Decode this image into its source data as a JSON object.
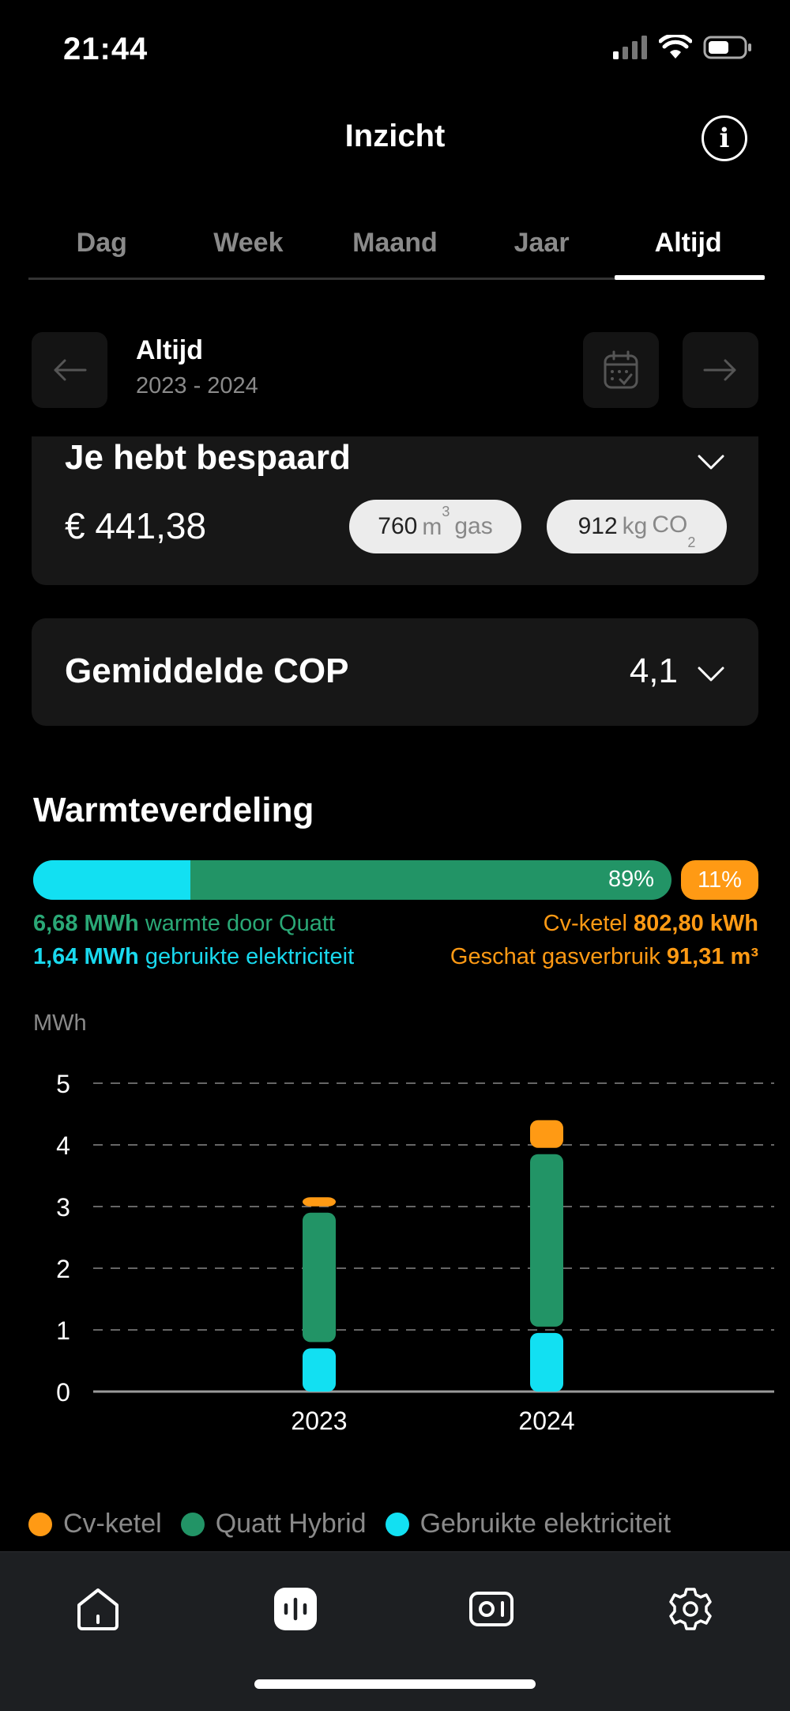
{
  "status_bar": {
    "time": "21:44"
  },
  "header": {
    "title": "Inzicht",
    "info_icon": "info-icon"
  },
  "tabs": [
    {
      "label": "Dag",
      "active": false
    },
    {
      "label": "Week",
      "active": false
    },
    {
      "label": "Maand",
      "active": false
    },
    {
      "label": "Jaar",
      "active": false
    },
    {
      "label": "Altijd",
      "active": true
    }
  ],
  "period": {
    "title": "Altijd",
    "range": "2023 - 2024"
  },
  "savings": {
    "title": "Je hebt bespaard",
    "amount": "€ 441,38",
    "gas_value": "760",
    "gas_unit_base": "m",
    "gas_unit_sup": "3",
    "gas_label": "gas",
    "co2_value": "912",
    "co2_unit": "kg",
    "co2_label": "CO",
    "co2_sub": "2"
  },
  "cop": {
    "title": "Gemiddelde COP",
    "value": "4,1"
  },
  "heat_distribution": {
    "title": "Warmteverdeling",
    "quatt_percent": 89,
    "cv_percent": 11,
    "electricity_fraction_of_quatt": 0.246,
    "quatt_percent_label": "89%",
    "cv_percent_label": "11%",
    "quatt_heat_value": "6,68 MWh",
    "quatt_heat_label": "warmte door Quatt",
    "electricity_value": "1,64 MWh",
    "electricity_label": "gebruikte elektriciteit",
    "cv_label": "Cv-ketel",
    "cv_value": "802,80 kWh",
    "gas_estimate_label": "Geschat gasverbruik",
    "gas_estimate_value": "91,31 m³"
  },
  "chart_data": {
    "type": "bar",
    "stacked": true,
    "ylabel": "MWh",
    "ylim": [
      0,
      5
    ],
    "yticks": [
      "0",
      "1",
      "2",
      "3",
      "4",
      "5"
    ],
    "categories": [
      "2023",
      "2024"
    ],
    "series": [
      {
        "name": "Gebruikte elektriciteit",
        "color": "#12e0f2",
        "values": [
          0.7,
          0.95
        ]
      },
      {
        "name": "Quatt Hybrid",
        "color": "#229466",
        "values": [
          2.2,
          2.9
        ]
      },
      {
        "name": "Cv-ketel",
        "color": "#ff9a14",
        "values": [
          0.25,
          0.55
        ]
      }
    ],
    "grid": true,
    "legend_position": "bottom"
  },
  "bottom_nav": [
    {
      "icon": "home-icon",
      "active": false
    },
    {
      "icon": "insights-icon",
      "active": true
    },
    {
      "icon": "device-icon",
      "active": false
    },
    {
      "icon": "settings-icon",
      "active": false
    }
  ],
  "colors": {
    "electricity": "#12e0f2",
    "quatt": "#229466",
    "cv": "#ff9a14"
  }
}
